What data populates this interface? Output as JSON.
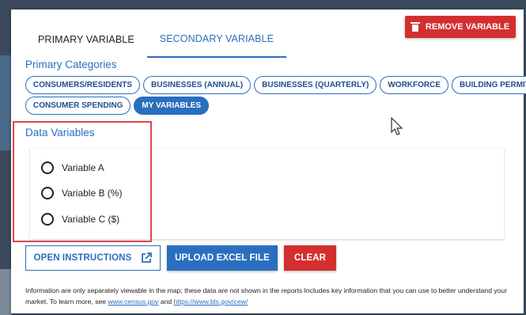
{
  "tabs": [
    {
      "label": "PRIMARY VARIABLE",
      "active": false
    },
    {
      "label": "SECONDARY VARIABLE",
      "active": true
    }
  ],
  "remove_button": {
    "label": "REMOVE VARIABLE",
    "icon": "trash-icon"
  },
  "primary_categories": {
    "title": "Primary Categories",
    "chips": [
      {
        "label": "CONSUMERS/RESIDENTS",
        "active": false
      },
      {
        "label": "BUSINESSES (ANNUAL)",
        "active": false
      },
      {
        "label": "BUSINESSES (QUARTERLY)",
        "active": false
      },
      {
        "label": "WORKFORCE",
        "active": false
      },
      {
        "label": "BUILDING PERMITS",
        "active": false
      },
      {
        "label": "CONSUMER SPENDING",
        "active": false
      },
      {
        "label": "MY VARIABLES",
        "active": true
      }
    ]
  },
  "data_variables": {
    "title": "Data Variables",
    "options": [
      {
        "label": "Variable A",
        "selected": false
      },
      {
        "label": "Variable B (%)",
        "selected": false
      },
      {
        "label": "Variable C ($)",
        "selected": false
      }
    ]
  },
  "actions": {
    "open_instructions": "OPEN INSTRUCTIONS",
    "upload_excel": "UPLOAD EXCEL FILE",
    "clear": "CLEAR"
  },
  "footnote": {
    "text_1": "Information are only separately viewable in the map; these data are not shown in the reports Includes key information that you can use to better understand your market. To learn more, see ",
    "link_1": "www.census.gov",
    "text_2": " and ",
    "link_2": "https://www.bls.gov/cew/"
  },
  "colors": {
    "accent": "#2a6fbf",
    "danger": "#d32f2f",
    "highlight": "#e0474c"
  }
}
